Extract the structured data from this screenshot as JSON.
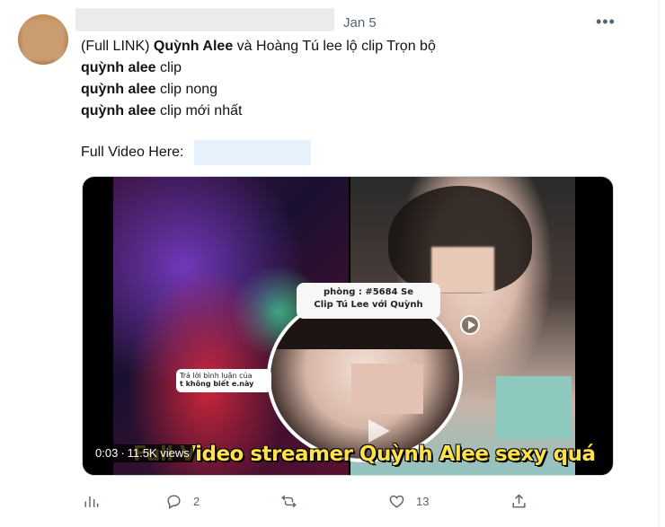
{
  "tweet": {
    "date": "Jan 5",
    "more_glyph": "•••",
    "lines": [
      {
        "prefix": "(Full LINK) ",
        "bold": "Quỳnh Alee",
        "rest": " và Hoàng Tú lee lộ clip Trọn bộ"
      },
      {
        "prefix": "",
        "bold": "quỳnh alee",
        "rest": " clip"
      },
      {
        "prefix": "",
        "bold": "quỳnh alee",
        "rest": " clip nong"
      },
      {
        "prefix": "",
        "bold": "quỳnh alee",
        "rest": " clip mới nhất"
      }
    ],
    "full_video_label": "Full Video Here:"
  },
  "media": {
    "duration": "0:03",
    "views": "11.5K views",
    "caption": "Full Video streamer Quỳnh Alee sexy quá",
    "overlay_label_1": "phòng : #5684 Se",
    "overlay_label_2": "Clip Tú Lee với Quỳnh",
    "comment_1": "Trả lời bình luận của",
    "comment_2": "t không biết e.này"
  },
  "actions": {
    "replies": "2",
    "retweets": "",
    "likes": "13"
  },
  "icons": {
    "views": "bar-chart-icon",
    "reply": "reply-icon",
    "retweet": "retweet-icon",
    "like": "heart-icon",
    "share": "share-icon",
    "more": "more-dots-icon"
  },
  "colors": {
    "text": "#0f1419",
    "muted": "#536471",
    "caption": "#ffe14a"
  }
}
